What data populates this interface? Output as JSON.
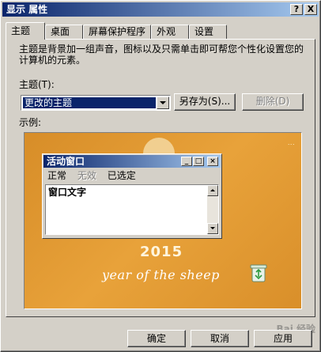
{
  "window": {
    "title": "显示 属性",
    "help_btn": "?",
    "close_btn": "X"
  },
  "tabs": [
    {
      "label": "主题",
      "active": true
    },
    {
      "label": "桌面",
      "active": false
    },
    {
      "label": "屏幕保护程序",
      "active": false
    },
    {
      "label": "外观",
      "active": false
    },
    {
      "label": "设置",
      "active": false
    }
  ],
  "themes_panel": {
    "description": "主题是背景加一组声音，图标以及只需单击即可帮您个性化设置您的计算机的元素。",
    "theme_label": "主题(T):",
    "theme_value": "更改的主题",
    "save_as_label": "另存为(S)...",
    "delete_label": "删除(D)",
    "sample_label": "示例:"
  },
  "preview": {
    "corner_text": "...",
    "year_number": "2015",
    "year_text": "year of the sheep",
    "active_window": {
      "title": "活动窗口",
      "menu": [
        "正常",
        "无效",
        "已选定"
      ],
      "window_text": "窗口文字"
    }
  },
  "bottom_buttons": {
    "ok": "确定",
    "cancel": "取消",
    "apply": "应用"
  },
  "watermark": "Bai 经验"
}
